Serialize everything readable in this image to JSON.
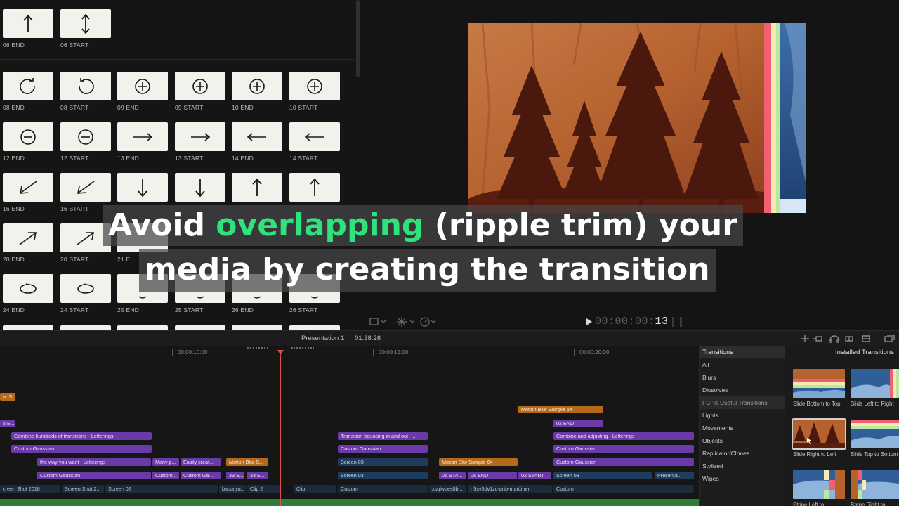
{
  "browser": {
    "thumbs": [
      {
        "label": "06 END",
        "icon": "arrow-up-icon"
      },
      {
        "label": "06 START",
        "icon": "arrow-updown-icon"
      },
      {
        "label": "08 END",
        "icon": "rotate-cw-icon"
      },
      {
        "label": "08 START",
        "icon": "rotate-ccw-icon"
      },
      {
        "label": "09 END",
        "icon": "plus-circle-icon"
      },
      {
        "label": "09 START",
        "icon": "plus-circle-icon"
      },
      {
        "label": "10 END",
        "icon": "plus-circle-icon"
      },
      {
        "label": "10 START",
        "icon": "plus-circle-icon"
      },
      {
        "label": "12 END",
        "icon": "minus-circle-icon"
      },
      {
        "label": "12 START",
        "icon": "minus-circle-icon"
      },
      {
        "label": "13 END",
        "icon": "arrow-right-icon"
      },
      {
        "label": "13 START",
        "icon": "arrow-right-icon"
      },
      {
        "label": "14 END",
        "icon": "arrow-left-icon"
      },
      {
        "label": "14 START",
        "icon": "arrow-left-icon"
      },
      {
        "label": "16 END",
        "icon": "arrow-downleft-icon"
      },
      {
        "label": "16 START",
        "icon": "arrow-downleft-icon"
      },
      {
        "label": "",
        "icon": "arrow-down-icon"
      },
      {
        "label": "",
        "icon": "arrow-down-icon"
      },
      {
        "label": "",
        "icon": "arrow-up-icon"
      },
      {
        "label": "",
        "icon": "arrow-up-icon"
      },
      {
        "label": "20 END",
        "icon": "arrow-upright-icon"
      },
      {
        "label": "20 START",
        "icon": "arrow-upright-icon"
      },
      {
        "label": "21 E",
        "icon": "blank-icon"
      },
      {
        "label": "24 END",
        "icon": "ellipse-icon"
      },
      {
        "label": "24 START",
        "icon": "ellipse-icon"
      },
      {
        "label": "25 END",
        "icon": "smile-curve-icon"
      },
      {
        "label": "25 START",
        "icon": "smile-curve-icon"
      },
      {
        "label": "26 END",
        "icon": "smile-curve-icon"
      },
      {
        "label": "26 START",
        "icon": "smile-curve-icon"
      }
    ]
  },
  "viewer": {
    "timecode_dim": "00:00:00:",
    "timecode_frames": "13"
  },
  "timeline": {
    "project_name": "Presentation 1",
    "duration": "01:38:26",
    "ruler": [
      "00:00:10:00",
      "00:00:15:00",
      "00:00:20:00"
    ],
    "clips": [
      {
        "text": "ur S...",
        "color": "orange"
      },
      {
        "text": "5 E...",
        "color": "purple"
      },
      {
        "text": "Motion Blur Sample 64",
        "color": "orange"
      },
      {
        "text": "02 END",
        "color": "purple"
      },
      {
        "text": "Combine hundreds of transitions - Letterings",
        "color": "purple"
      },
      {
        "text": "Transition bouncing in and out -...",
        "color": "purple"
      },
      {
        "text": "Combine and adjusting - Letterings",
        "color": "purple"
      },
      {
        "text": "Custom Gaussian",
        "color": "purple"
      },
      {
        "text": "Custom Gaussian",
        "color": "purple"
      },
      {
        "text": "Custom Gaussian",
        "color": "purple"
      },
      {
        "text": "the way you want - Letterings",
        "color": "purple"
      },
      {
        "text": "Many p...",
        "color": "purple"
      },
      {
        "text": "Easily creat...",
        "color": "purple"
      },
      {
        "text": "Motion Blur S...",
        "color": "orange"
      },
      {
        "text": "Screen 03",
        "color": "blue"
      },
      {
        "text": "Motion Blur Sample 64",
        "color": "orange"
      },
      {
        "text": "Custom Gaussian",
        "color": "purple"
      },
      {
        "text": "Custom Gaussian",
        "color": "purple"
      },
      {
        "text": "Custom...",
        "color": "purple"
      },
      {
        "text": "Custom Ga...",
        "color": "purple"
      },
      {
        "text": "33 S...",
        "color": "purple"
      },
      {
        "text": "33 E...",
        "color": "purple"
      },
      {
        "text": "Screen 03",
        "color": "blue"
      },
      {
        "text": "06 STA...",
        "color": "purple"
      },
      {
        "text": "06 END",
        "color": "purple"
      },
      {
        "text": "02 START",
        "color": "purple"
      },
      {
        "text": "Screen 03",
        "color": "blue"
      },
      {
        "text": "Presenta...",
        "color": "blue"
      },
      {
        "text": "creen Shot 2018",
        "color": "dark"
      },
      {
        "text": "Screen Shot 2...",
        "color": "dark"
      },
      {
        "text": "Screen 02",
        "color": "dark"
      },
      {
        "text": "baixa yu...",
        "color": "dark"
      },
      {
        "text": "Clip 2",
        "color": "dark"
      },
      {
        "text": "Clip",
        "color": "dark"
      },
      {
        "text": "Custom",
        "color": "dark"
      },
      {
        "text": "xsqlwues0b...",
        "color": "dark"
      },
      {
        "text": "rf5sv5dv1zc-arto-marttinen",
        "color": "dark"
      },
      {
        "text": "Custom",
        "color": "dark"
      }
    ]
  },
  "transitions": {
    "header": "Transitions",
    "installed_title": "Installed Transitions",
    "categories": [
      "All",
      "Blurs",
      "Dissolves",
      "FCPX Useful Transitions",
      "Lights",
      "Movements",
      "Objects",
      "Replicator/Clones",
      "Stylized",
      "Wipes"
    ],
    "selected_category": "FCPX Useful Transitions",
    "items": [
      {
        "name": "Slide Bottom to Top"
      },
      {
        "name": "Slide Left to Right"
      },
      {
        "name": "Slide Right to Left"
      },
      {
        "name": "Slide Top to Bottom"
      },
      {
        "name": "Stripe Left to"
      },
      {
        "name": "Stripe Right to"
      }
    ]
  },
  "caption": {
    "line1_pre": "Avoid ",
    "line1_highlight": "overlapping",
    "line1_post": " (ripple trim) your",
    "line2": "media by creating the transition"
  },
  "colors": {
    "accent_green": "#2ee37b",
    "playhead": "#e0504a",
    "clip_purple": "#6a3aa8",
    "clip_orange": "#b5691b",
    "clip_blue": "#1f3c5c"
  }
}
